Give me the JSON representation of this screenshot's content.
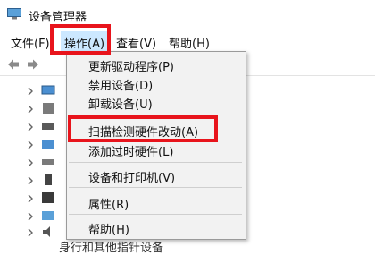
{
  "window": {
    "title": "设备管理器",
    "icon": "device-manager-icon"
  },
  "menubar": {
    "items": [
      "文件(F)",
      "操作(A)",
      "查看(V)",
      "帮助(H)"
    ],
    "active_index": 1
  },
  "toolbar": {
    "buttons": [
      "back-arrow-icon",
      "forward-arrow-icon"
    ]
  },
  "context_menu": {
    "items": [
      "更新驱动程序(P)",
      "禁用设备(D)",
      "卸载设备(U)",
      "扫描检测硬件改动(A)",
      "添加过时硬件(L)",
      "设备和打印机(V)",
      "属性(R)",
      "帮助(H)"
    ],
    "highlighted_index": 3
  },
  "tree": {
    "partial_bottom_text": "身行和其他指针设备"
  },
  "annotation_color": "#e8141c"
}
